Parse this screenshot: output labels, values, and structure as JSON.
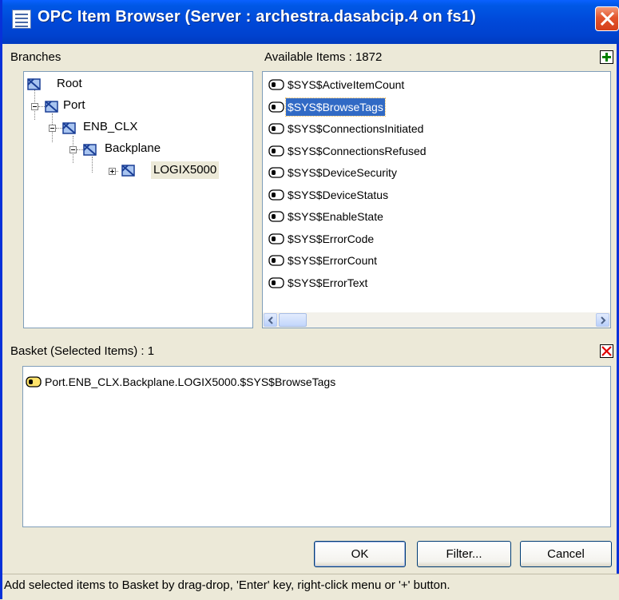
{
  "window": {
    "title": "OPC Item Browser (Server : archestra.dasabcip.4 on fs1)"
  },
  "branches": {
    "label": "Branches",
    "tree": [
      {
        "label": "Root"
      },
      {
        "label": "Port"
      },
      {
        "label": "ENB_CLX"
      },
      {
        "label": "Backplane"
      },
      {
        "label": "LOGIX5000"
      }
    ],
    "selected": "LOGIX5000"
  },
  "available": {
    "label": "Available Items : 1872",
    "items": [
      "$SYS$ActiveItemCount",
      "$SYS$BrowseTags",
      "$SYS$ConnectionsInitiated",
      "$SYS$ConnectionsRefused",
      "$SYS$DeviceSecurity",
      "$SYS$DeviceStatus",
      "$SYS$EnableState",
      "$SYS$ErrorCode",
      "$SYS$ErrorCount",
      "$SYS$ErrorText"
    ],
    "selected": "$SYS$BrowseTags"
  },
  "basket": {
    "label": "Basket (Selected Items) : 1",
    "items": [
      "Port.ENB_CLX.Backplane.LOGIX5000.$SYS$BrowseTags"
    ]
  },
  "buttons": {
    "ok": "OK",
    "filter": "Filter...",
    "cancel": "Cancel"
  },
  "status": "Add selected items to Basket by drag-drop, 'Enter' key, right-click menu or '+' button.",
  "icons": {
    "add": "plus-icon",
    "remove": "delete-x-icon",
    "close": "close-icon",
    "tree_node": "branch-node-icon",
    "item": "tag-item-icon"
  },
  "colors": {
    "titlebar": "#0048d8",
    "selection": "#316ac5",
    "add_green": "#008000",
    "remove_red": "#e00000"
  }
}
